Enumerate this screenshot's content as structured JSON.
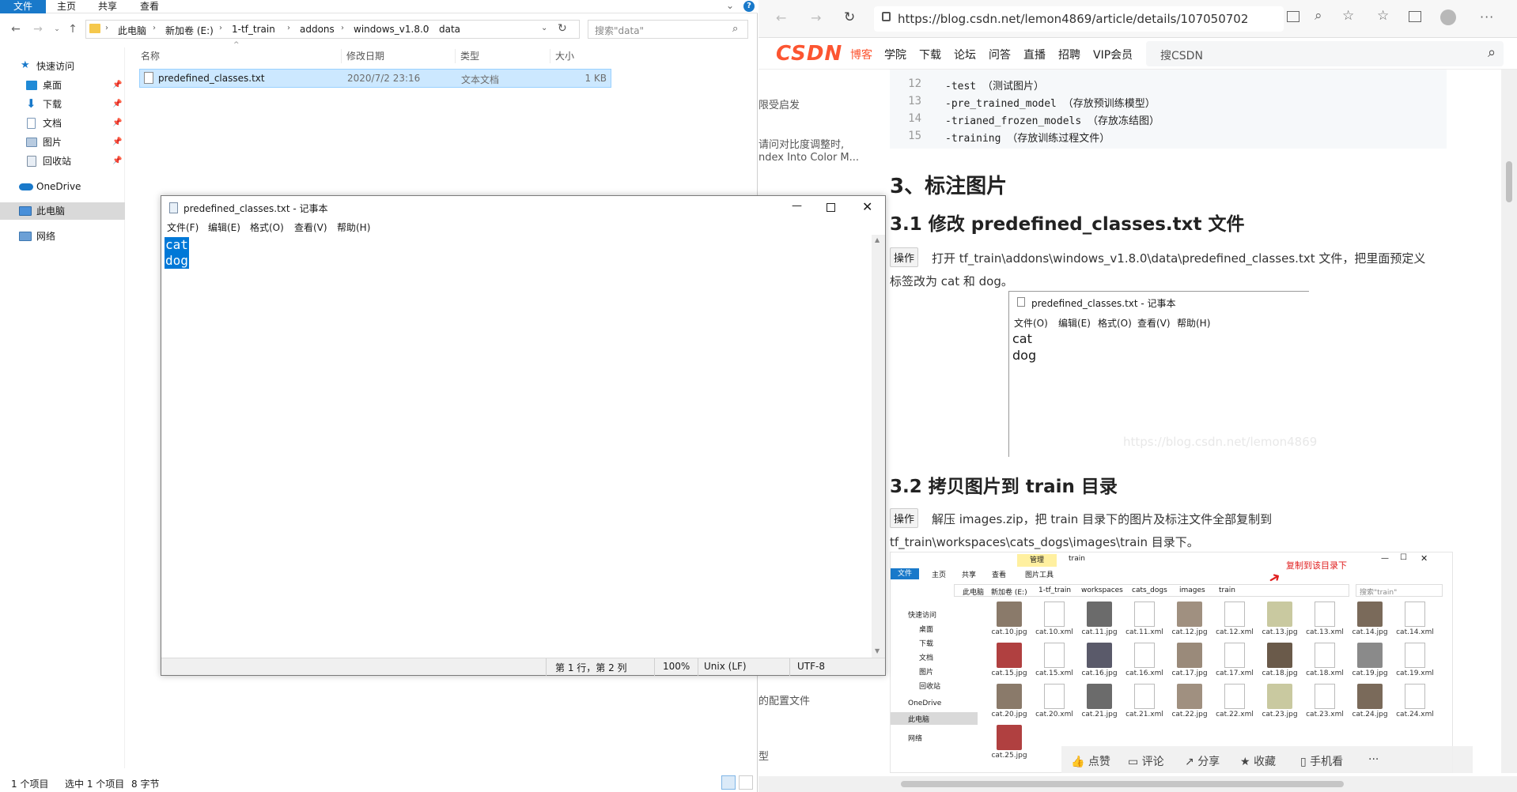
{
  "explorer": {
    "ribbon_tabs": [
      "文件",
      "主页",
      "共享",
      "查看"
    ],
    "breadcrumb": [
      "此电脑",
      "新加卷 (E:)",
      "1-tf_train",
      "addons",
      "windows_v1.8.0",
      "data"
    ],
    "search_placeholder": "搜索\"data\"",
    "nav": {
      "quick_access": "快速访问",
      "desktop": "桌面",
      "downloads": "下载",
      "documents": "文档",
      "pictures": "图片",
      "recycle": "回收站",
      "onedrive": "OneDrive",
      "this_pc": "此电脑",
      "network": "网络"
    },
    "columns": {
      "name": "名称",
      "date": "修改日期",
      "type": "类型",
      "size": "大小"
    },
    "file": {
      "name": "predefined_classes.txt",
      "date": "2020/7/2 23:16",
      "type": "文本文档",
      "size": "1 KB"
    },
    "status": {
      "count": "1 个项目",
      "selected": "选中 1 个项目",
      "bytes": "8 字节"
    }
  },
  "notepad": {
    "title": "predefined_classes.txt - 记事本",
    "menu": [
      "文件(F)",
      "编辑(E)",
      "格式(O)",
      "查看(V)",
      "帮助(H)"
    ],
    "lines": [
      "cat",
      "dog"
    ],
    "status": {
      "position": "第 1 行，第 2 列",
      "zoom": "100%",
      "eol": "Unix (LF)",
      "encoding": "UTF-8"
    }
  },
  "browser": {
    "url": "https://blog.csdn.net/lemon4869/article/details/107050702",
    "logo": "CSDN",
    "nav": [
      "博客",
      "学院",
      "下载",
      "论坛",
      "问答",
      "直播",
      "招聘",
      "VIP会员"
    ],
    "search_placeholder": "搜CSDN",
    "sidebar_snippets": [
      "限受启发",
      "请问对比度调整时,",
      "ndex Into Color M...",
      "的配置文件",
      "型"
    ],
    "code": [
      {
        "ln": "12",
        "text": "    -test   （测试图片）"
      },
      {
        "ln": "13",
        "text": "  -pre_trained_model  （存放预训练模型）"
      },
      {
        "ln": "14",
        "text": "  -trianed_frozen_models  （存放冻结图）"
      },
      {
        "ln": "15",
        "text": "  -training   （存放训练过程文件）"
      }
    ],
    "h_annotate": "3、标注图片",
    "h_31": "3.1 修改 predefined_classes.txt 文件",
    "op_label": "操作",
    "p31_a": "打开 tf_train\\addons\\windows_v1.8.0\\data\\predefined_classes.txt 文件，把里面预定义",
    "p31_b": "标签改为 cat 和 dog。",
    "embedded_notepad": {
      "title": "predefined_classes.txt - 记事本",
      "menu": [
        "文件(O)",
        "编辑(E)",
        "格式(O)",
        "查看(V)",
        "帮助(H)"
      ],
      "lines": [
        "cat",
        "dog"
      ]
    },
    "watermark": "https://blog.csdn.net/lemon4869",
    "h_32": "3.2 拷贝图片到 train 目录",
    "p32_a": "解压 images.zip，把 train 目录下的图片及标注文件全部复制到",
    "p32_b": "tf_train\\workspaces\\cats_dogs\\images\\train 目录下。",
    "embedded_explorer": {
      "manage": "管理",
      "title": "train",
      "tabs": [
        "文件",
        "主页",
        "共享",
        "查看",
        "图片工具"
      ],
      "annotation": "复制到该目录下",
      "path": [
        "此电脑",
        "新加卷 (E:)",
        "1-tf_train",
        "workspaces",
        "cats_dogs",
        "images",
        "train"
      ],
      "search": "搜索\"train\"",
      "nav": [
        "快速访问",
        "桌面",
        "下载",
        "文档",
        "图片",
        "回收站",
        "OneDrive",
        "此电脑",
        "网络"
      ],
      "files": [
        "cat.10.jpg",
        "cat.10.xml",
        "cat.11.jpg",
        "cat.11.xml",
        "cat.12.jpg",
        "cat.12.xml",
        "cat.13.jpg",
        "cat.13.xml",
        "cat.14.jpg",
        "cat.14.xml",
        "cat.15.jpg",
        "cat.15.xml",
        "cat.16.jpg",
        "cat.16.xml",
        "cat.17.jpg",
        "cat.17.xml",
        "cat.18.jpg",
        "cat.18.xml",
        "cat.19.jpg",
        "cat.19.xml",
        "cat.20.jpg",
        "cat.20.xml",
        "cat.21.jpg",
        "cat.21.xml",
        "cat.22.jpg",
        "cat.22.xml",
        "cat.23.jpg",
        "cat.23.xml",
        "cat.24.jpg",
        "cat.24.xml",
        "cat.25.jpg"
      ]
    },
    "actions": {
      "like": "点赞",
      "comment": "评论",
      "share": "分享",
      "favorite": "收藏",
      "mobile": "手机看",
      "more": "···"
    }
  },
  "colors": {
    "accent": "#1979ca",
    "selection": "#0078d7",
    "csdn_red": "#fc5531"
  }
}
